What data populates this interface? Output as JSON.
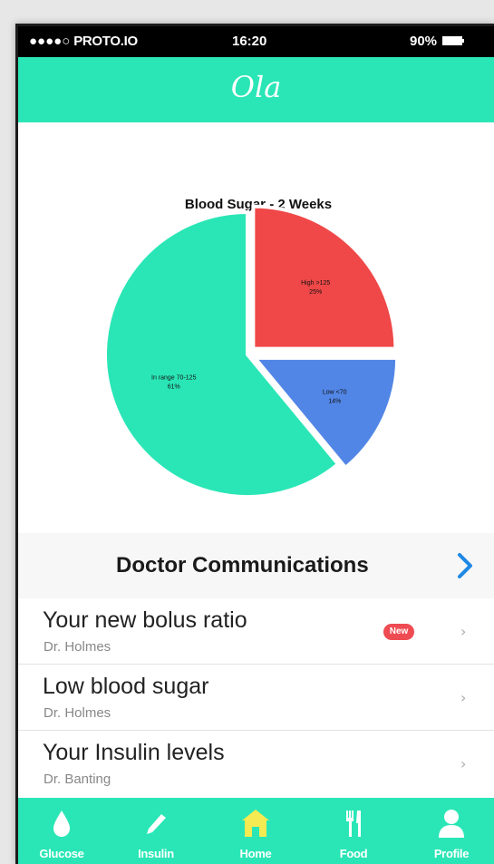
{
  "status_bar": {
    "carrier": "PROTO.IO",
    "signal_dots": "●●●●○",
    "time": "16:20",
    "battery": "90%"
  },
  "nav": {
    "title": "Ola"
  },
  "chart_data": {
    "type": "pie",
    "title": "Blood Sugar - 2 Weeks",
    "slices": [
      {
        "label": "High >125",
        "value": 25,
        "value_label": "25%",
        "color": "#f04848"
      },
      {
        "label": "Low <70",
        "value": 14,
        "value_label": "14%",
        "color": "#5286e6"
      },
      {
        "label": "In range 70-125",
        "value": 61,
        "value_label": "61%",
        "color": "#2ae6b6"
      }
    ]
  },
  "doctor": {
    "header": "Doctor Communications",
    "messages": [
      {
        "title": "Your new bolus ratio",
        "from": "Dr. Holmes",
        "badge": "New"
      },
      {
        "title": "Low blood sugar",
        "from": "Dr. Holmes"
      },
      {
        "title": "Your Insulin levels",
        "from": "Dr. Banting"
      }
    ],
    "chevron_color": "#1e88e5"
  },
  "tabs": [
    {
      "label": "Glucose",
      "icon": "drop-icon"
    },
    {
      "label": "Insulin",
      "icon": "pen-icon"
    },
    {
      "label": "Home",
      "icon": "home-icon",
      "active": true
    },
    {
      "label": "Food",
      "icon": "utensils-icon"
    },
    {
      "label": "Profile",
      "icon": "person-icon"
    }
  ],
  "colors": {
    "accent": "#2ae6b6",
    "active_tab": "#f5ea52",
    "badge": "#ef4b52"
  }
}
